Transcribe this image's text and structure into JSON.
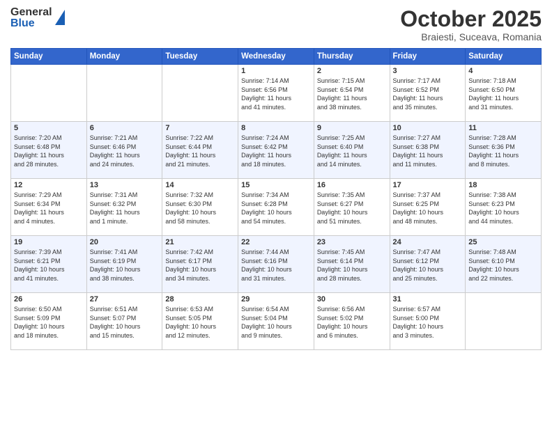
{
  "header": {
    "logo_general": "General",
    "logo_blue": "Blue",
    "month_title": "October 2025",
    "subtitle": "Braiesti, Suceava, Romania"
  },
  "days_of_week": [
    "Sunday",
    "Monday",
    "Tuesday",
    "Wednesday",
    "Thursday",
    "Friday",
    "Saturday"
  ],
  "weeks": [
    {
      "row": 1,
      "cells": [
        {
          "day": "",
          "content": ""
        },
        {
          "day": "",
          "content": ""
        },
        {
          "day": "",
          "content": ""
        },
        {
          "day": "1",
          "content": "Sunrise: 7:14 AM\nSunset: 6:56 PM\nDaylight: 11 hours\nand 41 minutes."
        },
        {
          "day": "2",
          "content": "Sunrise: 7:15 AM\nSunset: 6:54 PM\nDaylight: 11 hours\nand 38 minutes."
        },
        {
          "day": "3",
          "content": "Sunrise: 7:17 AM\nSunset: 6:52 PM\nDaylight: 11 hours\nand 35 minutes."
        },
        {
          "day": "4",
          "content": "Sunrise: 7:18 AM\nSunset: 6:50 PM\nDaylight: 11 hours\nand 31 minutes."
        }
      ]
    },
    {
      "row": 2,
      "cells": [
        {
          "day": "5",
          "content": "Sunrise: 7:20 AM\nSunset: 6:48 PM\nDaylight: 11 hours\nand 28 minutes."
        },
        {
          "day": "6",
          "content": "Sunrise: 7:21 AM\nSunset: 6:46 PM\nDaylight: 11 hours\nand 24 minutes."
        },
        {
          "day": "7",
          "content": "Sunrise: 7:22 AM\nSunset: 6:44 PM\nDaylight: 11 hours\nand 21 minutes."
        },
        {
          "day": "8",
          "content": "Sunrise: 7:24 AM\nSunset: 6:42 PM\nDaylight: 11 hours\nand 18 minutes."
        },
        {
          "day": "9",
          "content": "Sunrise: 7:25 AM\nSunset: 6:40 PM\nDaylight: 11 hours\nand 14 minutes."
        },
        {
          "day": "10",
          "content": "Sunrise: 7:27 AM\nSunset: 6:38 PM\nDaylight: 11 hours\nand 11 minutes."
        },
        {
          "day": "11",
          "content": "Sunrise: 7:28 AM\nSunset: 6:36 PM\nDaylight: 11 hours\nand 8 minutes."
        }
      ]
    },
    {
      "row": 3,
      "cells": [
        {
          "day": "12",
          "content": "Sunrise: 7:29 AM\nSunset: 6:34 PM\nDaylight: 11 hours\nand 4 minutes."
        },
        {
          "day": "13",
          "content": "Sunrise: 7:31 AM\nSunset: 6:32 PM\nDaylight: 11 hours\nand 1 minute."
        },
        {
          "day": "14",
          "content": "Sunrise: 7:32 AM\nSunset: 6:30 PM\nDaylight: 10 hours\nand 58 minutes."
        },
        {
          "day": "15",
          "content": "Sunrise: 7:34 AM\nSunset: 6:28 PM\nDaylight: 10 hours\nand 54 minutes."
        },
        {
          "day": "16",
          "content": "Sunrise: 7:35 AM\nSunset: 6:27 PM\nDaylight: 10 hours\nand 51 minutes."
        },
        {
          "day": "17",
          "content": "Sunrise: 7:37 AM\nSunset: 6:25 PM\nDaylight: 10 hours\nand 48 minutes."
        },
        {
          "day": "18",
          "content": "Sunrise: 7:38 AM\nSunset: 6:23 PM\nDaylight: 10 hours\nand 44 minutes."
        }
      ]
    },
    {
      "row": 4,
      "cells": [
        {
          "day": "19",
          "content": "Sunrise: 7:39 AM\nSunset: 6:21 PM\nDaylight: 10 hours\nand 41 minutes."
        },
        {
          "day": "20",
          "content": "Sunrise: 7:41 AM\nSunset: 6:19 PM\nDaylight: 10 hours\nand 38 minutes."
        },
        {
          "day": "21",
          "content": "Sunrise: 7:42 AM\nSunset: 6:17 PM\nDaylight: 10 hours\nand 34 minutes."
        },
        {
          "day": "22",
          "content": "Sunrise: 7:44 AM\nSunset: 6:16 PM\nDaylight: 10 hours\nand 31 minutes."
        },
        {
          "day": "23",
          "content": "Sunrise: 7:45 AM\nSunset: 6:14 PM\nDaylight: 10 hours\nand 28 minutes."
        },
        {
          "day": "24",
          "content": "Sunrise: 7:47 AM\nSunset: 6:12 PM\nDaylight: 10 hours\nand 25 minutes."
        },
        {
          "day": "25",
          "content": "Sunrise: 7:48 AM\nSunset: 6:10 PM\nDaylight: 10 hours\nand 22 minutes."
        }
      ]
    },
    {
      "row": 5,
      "cells": [
        {
          "day": "26",
          "content": "Sunrise: 6:50 AM\nSunset: 5:09 PM\nDaylight: 10 hours\nand 18 minutes."
        },
        {
          "day": "27",
          "content": "Sunrise: 6:51 AM\nSunset: 5:07 PM\nDaylight: 10 hours\nand 15 minutes."
        },
        {
          "day": "28",
          "content": "Sunrise: 6:53 AM\nSunset: 5:05 PM\nDaylight: 10 hours\nand 12 minutes."
        },
        {
          "day": "29",
          "content": "Sunrise: 6:54 AM\nSunset: 5:04 PM\nDaylight: 10 hours\nand 9 minutes."
        },
        {
          "day": "30",
          "content": "Sunrise: 6:56 AM\nSunset: 5:02 PM\nDaylight: 10 hours\nand 6 minutes."
        },
        {
          "day": "31",
          "content": "Sunrise: 6:57 AM\nSunset: 5:00 PM\nDaylight: 10 hours\nand 3 minutes."
        },
        {
          "day": "",
          "content": ""
        }
      ]
    }
  ]
}
